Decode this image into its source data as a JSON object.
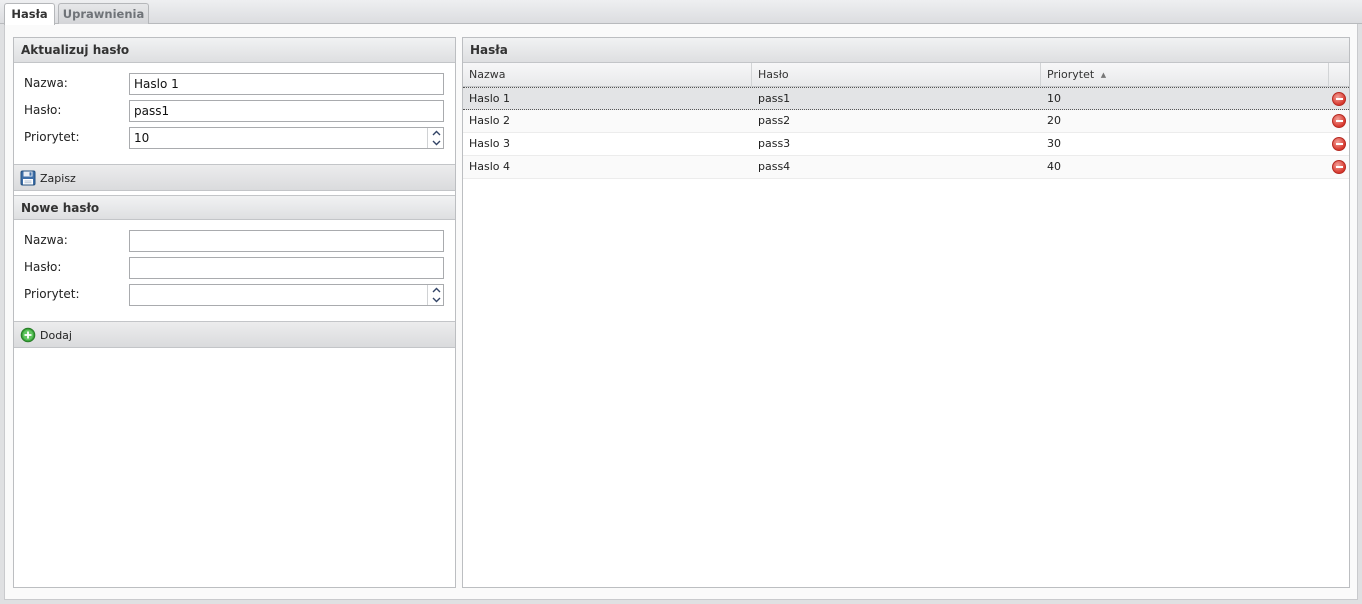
{
  "tabs": [
    {
      "label": "Hasła",
      "active": true
    },
    {
      "label": "Uprawnienia",
      "active": false
    }
  ],
  "update_panel": {
    "title": "Aktualizuj hasło",
    "fields": {
      "name_label": "Nazwa:",
      "name_value": "Haslo 1",
      "password_label": "Hasło:",
      "password_value": "pass1",
      "priority_label": "Priorytet:",
      "priority_value": "10"
    },
    "save_label": "Zapisz"
  },
  "new_panel": {
    "title": "Nowe hasło",
    "fields": {
      "name_label": "Nazwa:",
      "name_value": "",
      "password_label": "Hasło:",
      "password_value": "",
      "priority_label": "Priorytet:",
      "priority_value": ""
    },
    "add_label": "Dodaj"
  },
  "grid": {
    "title": "Hasła",
    "columns": [
      "Nazwa",
      "Hasło",
      "Priorytet"
    ],
    "sort_indicator": "▲",
    "rows": [
      {
        "name": "Haslo 1",
        "password": "pass1",
        "priority": "10"
      },
      {
        "name": "Haslo 2",
        "password": "pass2",
        "priority": "20"
      },
      {
        "name": "Haslo 3",
        "password": "pass3",
        "priority": "30"
      },
      {
        "name": "Haslo 4",
        "password": "pass4",
        "priority": "40"
      }
    ]
  },
  "icons": {
    "save": "floppy-disk-icon",
    "add": "add-circle-icon",
    "delete": "delete-circle-icon",
    "sort": "sort-ascending-icon"
  },
  "colors": {
    "delete": "#d8382d",
    "add": "#3aa53a",
    "save": "#3d6ea8"
  }
}
